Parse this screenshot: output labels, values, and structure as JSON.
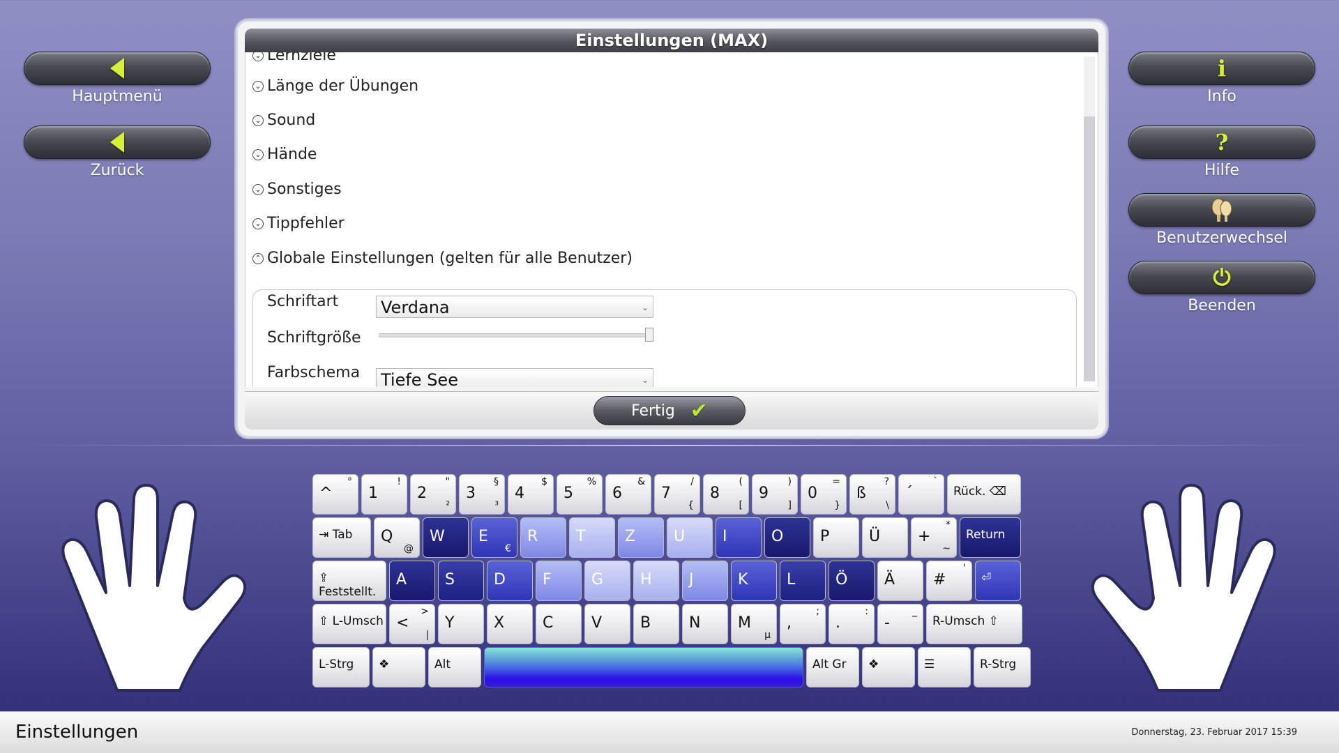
{
  "sidebar_left": [
    {
      "id": "main-menu",
      "label": "Hauptmenü",
      "icon": "back-arrow-icon"
    },
    {
      "id": "back",
      "label": "Zurück",
      "icon": "back-arrow-icon"
    }
  ],
  "sidebar_right": [
    {
      "id": "info",
      "label": "Info",
      "icon": "info-icon",
      "glyph": "i"
    },
    {
      "id": "help",
      "label": "Hilfe",
      "icon": "help-icon",
      "glyph": "?"
    },
    {
      "id": "switch-user",
      "label": "Benutzerwechsel",
      "icon": "users-icon"
    },
    {
      "id": "quit",
      "label": "Beenden",
      "icon": "power-icon",
      "glyph": "⏻"
    }
  ],
  "dialog": {
    "title": "Einstellungen (MAX)",
    "sections": [
      {
        "label": "Lernziele",
        "expanded": false,
        "cut_off": true
      },
      {
        "label": "Länge der Übungen",
        "expanded": false
      },
      {
        "label": "Sound",
        "expanded": false
      },
      {
        "label": "Hände",
        "expanded": false
      },
      {
        "label": "Sonstiges",
        "expanded": false
      },
      {
        "label": "Tippfehler",
        "expanded": false
      },
      {
        "label": "Globale Einstellungen (gelten für alle Benutzer)",
        "expanded": true
      }
    ],
    "global": {
      "font_label": "Schriftart",
      "font_value": "Verdana",
      "size_label": "Schriftgröße",
      "size_value": 1.0,
      "scheme_label": "Farbschema",
      "scheme_value": "Tiefe See"
    },
    "done_label": "Fertig"
  },
  "keyboard": {
    "rows": [
      [
        {
          "m": "^",
          "t": "°"
        },
        {
          "m": "1",
          "t": "!"
        },
        {
          "m": "2",
          "t": "\"",
          "b": "²"
        },
        {
          "m": "3",
          "t": "§",
          "b": "³"
        },
        {
          "m": "4",
          "t": "$"
        },
        {
          "m": "5",
          "t": "%"
        },
        {
          "m": "6",
          "t": "&"
        },
        {
          "m": "7",
          "t": "/",
          "b": "{"
        },
        {
          "m": "8",
          "t": "(",
          "b": "["
        },
        {
          "m": "9",
          "t": ")",
          "b": "]"
        },
        {
          "m": "0",
          "t": "=",
          "b": "}"
        },
        {
          "m": "ß",
          "t": "?",
          "b": "\\"
        },
        {
          "m": "´",
          "t": "`"
        },
        {
          "fn": "Rück. ⌫"
        }
      ],
      [
        {
          "fn": "⇥ Tab"
        },
        {
          "m": "Q",
          "b": "@"
        },
        {
          "m": "W"
        },
        {
          "m": "E",
          "b": "€"
        },
        {
          "m": "R"
        },
        {
          "m": "T"
        },
        {
          "m": "Z"
        },
        {
          "m": "U"
        },
        {
          "m": "I"
        },
        {
          "m": "O"
        },
        {
          "m": "P"
        },
        {
          "m": "Ü"
        },
        {
          "m": "+",
          "t": "*",
          "b": "~"
        },
        {
          "fn": "Return"
        }
      ],
      [
        {
          "fn": "⇪ Feststellt."
        },
        {
          "m": "A"
        },
        {
          "m": "S"
        },
        {
          "m": "D"
        },
        {
          "m": "F"
        },
        {
          "m": "G"
        },
        {
          "m": "H"
        },
        {
          "m": "J"
        },
        {
          "m": "K"
        },
        {
          "m": "L"
        },
        {
          "m": "Ö"
        },
        {
          "m": "Ä"
        },
        {
          "m": "#",
          "t": "'"
        },
        {
          "fn": "⏎"
        }
      ],
      [
        {
          "fn": "⇧ L-Umsch"
        },
        {
          "m": "<",
          "t": ">",
          "b": "|"
        },
        {
          "m": "Y"
        },
        {
          "m": "X"
        },
        {
          "m": "C"
        },
        {
          "m": "V"
        },
        {
          "m": "B"
        },
        {
          "m": "N"
        },
        {
          "m": "M",
          "b": "µ"
        },
        {
          "m": ",",
          "t": ";"
        },
        {
          "m": ".",
          "t": ":"
        },
        {
          "m": "-",
          "t": "_"
        },
        {
          "fn": "R-Umsch ⇧"
        }
      ],
      [
        {
          "fn": "L-Strg"
        },
        {
          "fn": "❖"
        },
        {
          "fn": "Alt"
        },
        {
          "fn": ""
        },
        {
          "fn": "Alt Gr"
        },
        {
          "fn": "❖"
        },
        {
          "fn": "☰"
        },
        {
          "fn": "R-Strg"
        }
      ]
    ]
  },
  "status": {
    "title": "Einstellungen",
    "datetime": "Donnerstag, 23. Februar 2017 15:39"
  },
  "colors": {
    "accent": "#d6f03a",
    "background_top": "#8f8fc4",
    "background_bottom": "#2b2b74"
  }
}
